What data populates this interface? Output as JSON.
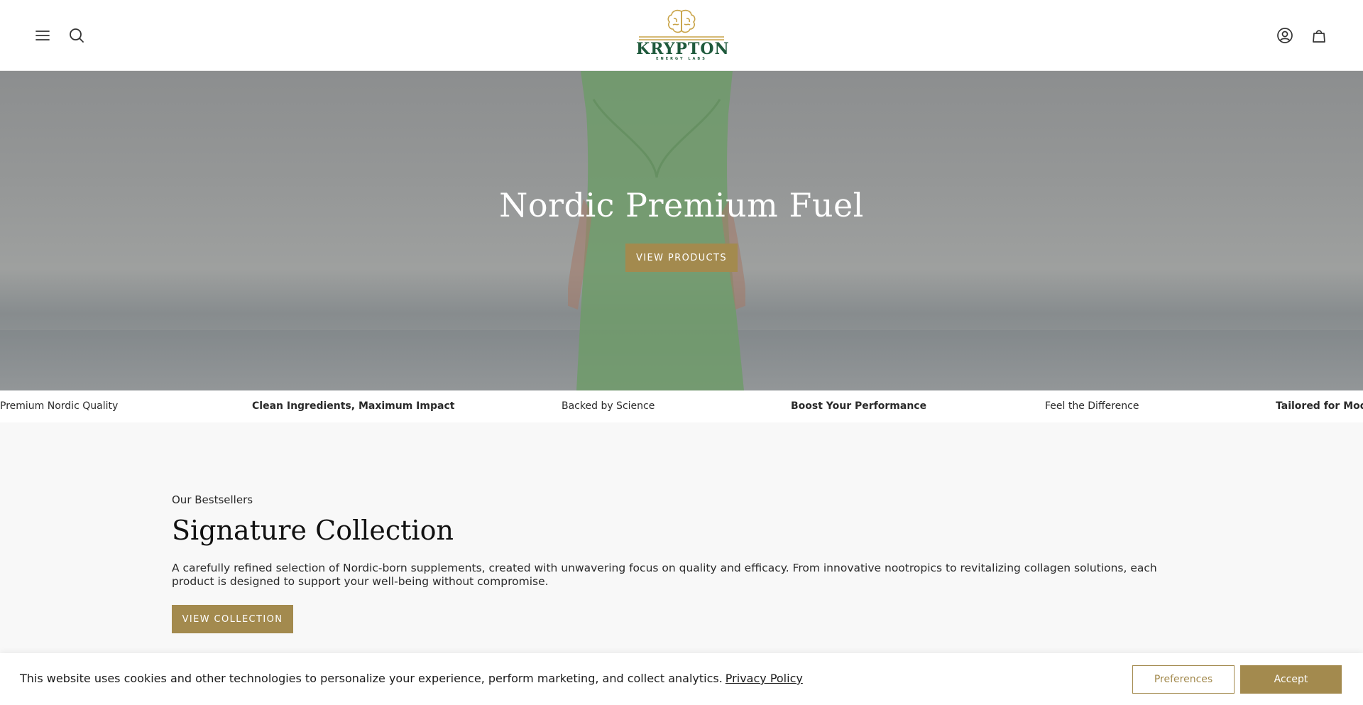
{
  "header": {
    "menu_icon": "hamburger-menu-icon",
    "search_icon": "search-icon",
    "account_icon": "account-icon",
    "cart_icon": "cart-bag-icon",
    "logo": {
      "name": "KRYPTON",
      "tagline": "ENERGY LABS",
      "icon": "brain-icon"
    }
  },
  "hero": {
    "title": "Nordic Premium Fuel",
    "button_label": "VIEW PRODUCTS"
  },
  "marquee": {
    "items": [
      {
        "label": "Premium Nordic Quality",
        "bold": false
      },
      {
        "label": "Clean Ingredients, Maximum Impact",
        "bold": true
      },
      {
        "label": "Backed by Science",
        "bold": false
      },
      {
        "label": "Boost Your Performance",
        "bold": true
      },
      {
        "label": "Feel the Difference",
        "bold": false
      },
      {
        "label": "Tailored for Modern",
        "bold": true
      }
    ]
  },
  "collection": {
    "eyebrow": "Our Bestsellers",
    "title": "Signature Collection",
    "description": "A carefully refined selection of Nordic-born supplements, created with unwavering focus on quality and efficacy. From innovative nootropics to revitalizing collagen solutions, each product is designed to support your well-being without compromise.",
    "button_label": "VIEW COLLECTION"
  },
  "cookie_banner": {
    "text": "This website uses cookies and other technologies to personalize your experience, perform marketing, and collect analytics.",
    "link_label": "Privacy Policy",
    "preferences_label": "Preferences",
    "accept_label": "Accept"
  },
  "colors": {
    "accent_gold": "#a38a4e",
    "brand_green": "#1f5a3c",
    "logo_gold": "#c9a449"
  }
}
